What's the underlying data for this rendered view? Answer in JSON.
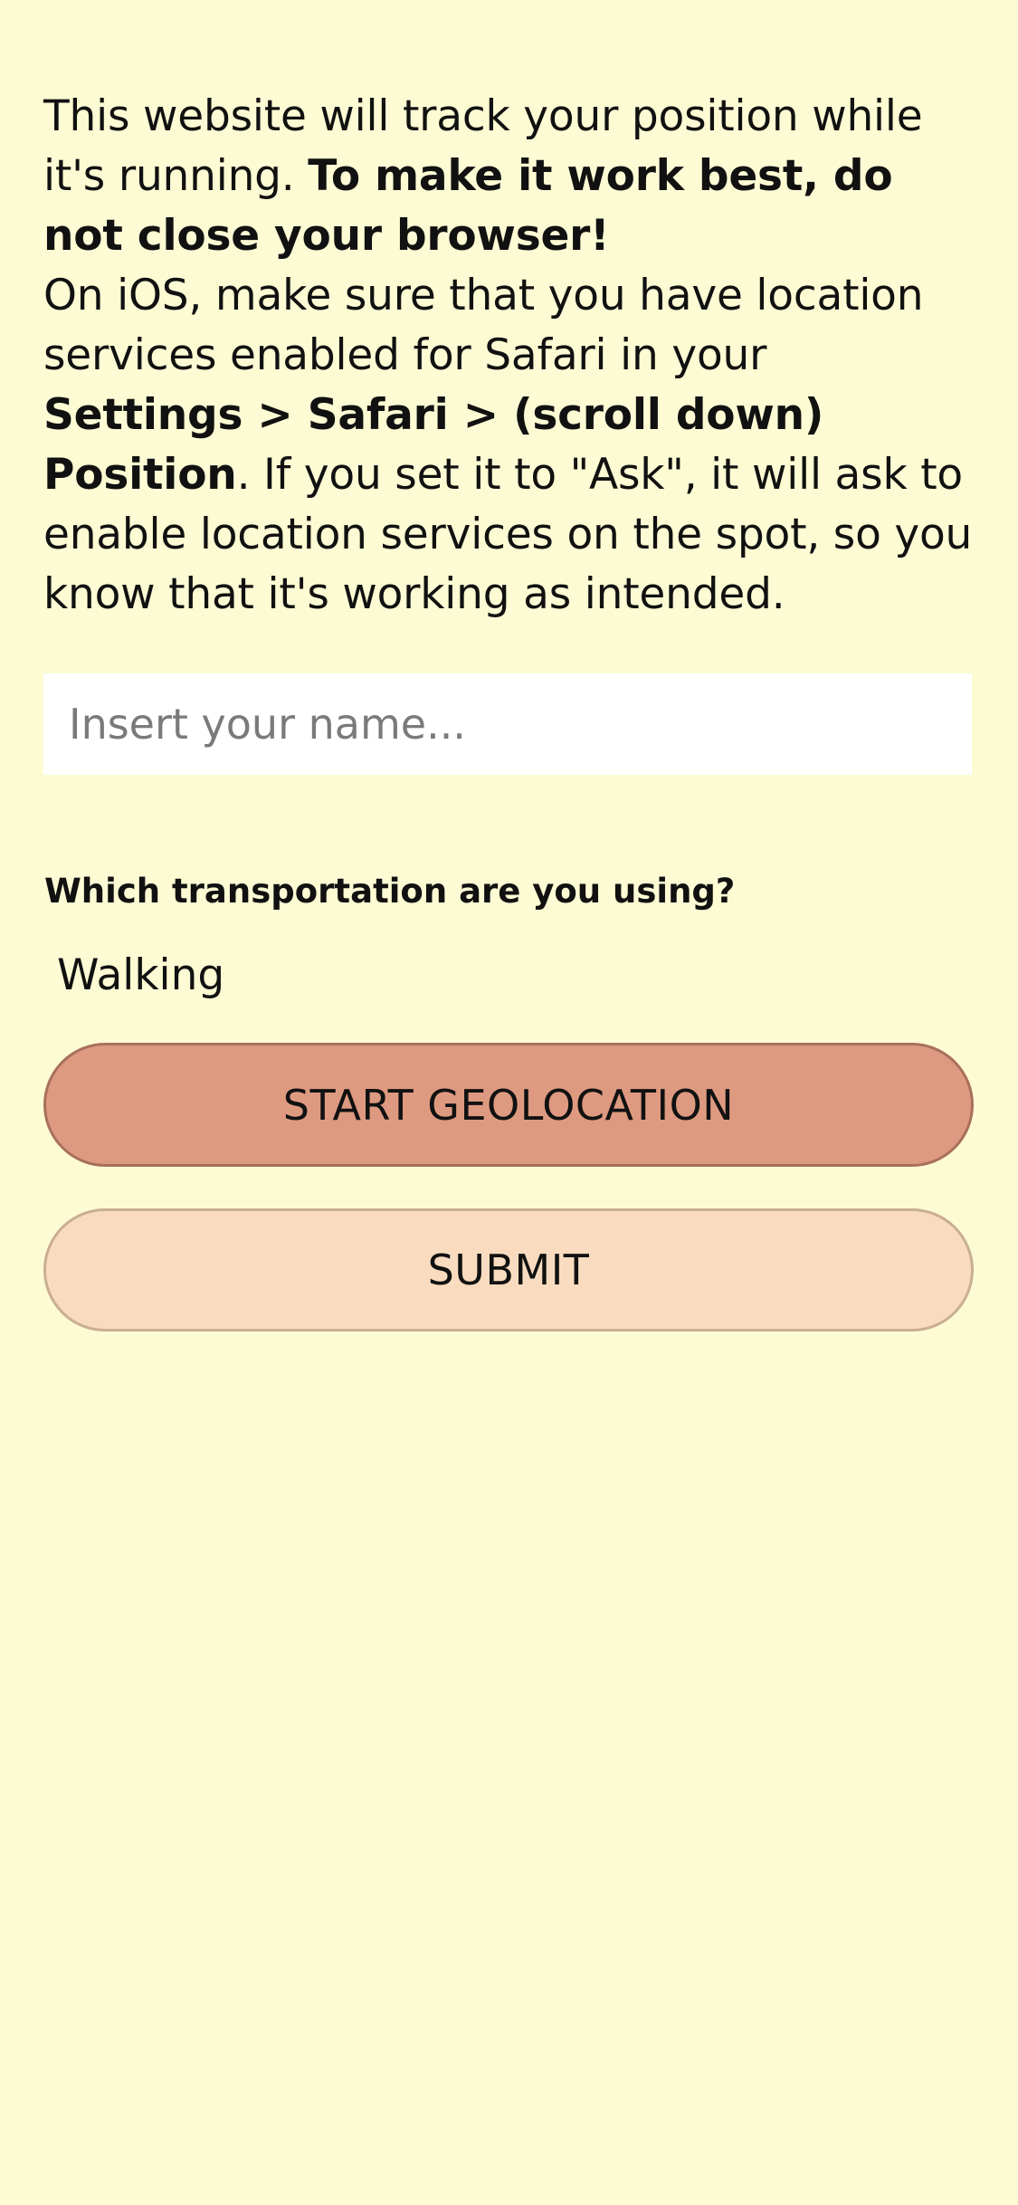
{
  "intro": {
    "text1": "This website will track your position while it's running. ",
    "bold1": "To make it work best, do not close your browser!",
    "text2": "On iOS, make sure that you have location services enabled for Safari in your ",
    "bold2": "Settings > Safari > (scroll down) Position",
    "text3": ". If you set it to \"Ask\", it will ask to enable location services on the spot, so you know that it's working as intended."
  },
  "name_input": {
    "placeholder": "Insert your name...",
    "value": ""
  },
  "transport": {
    "question": "Which transportation are you using?",
    "selected": "Walking"
  },
  "buttons": {
    "start_label": "START GEOLOCATION",
    "submit_label": "SUBMIT"
  },
  "colors": {
    "background": "#fdfbd4",
    "start_button": "#de9a80",
    "submit_button": "#f9dcbf"
  }
}
